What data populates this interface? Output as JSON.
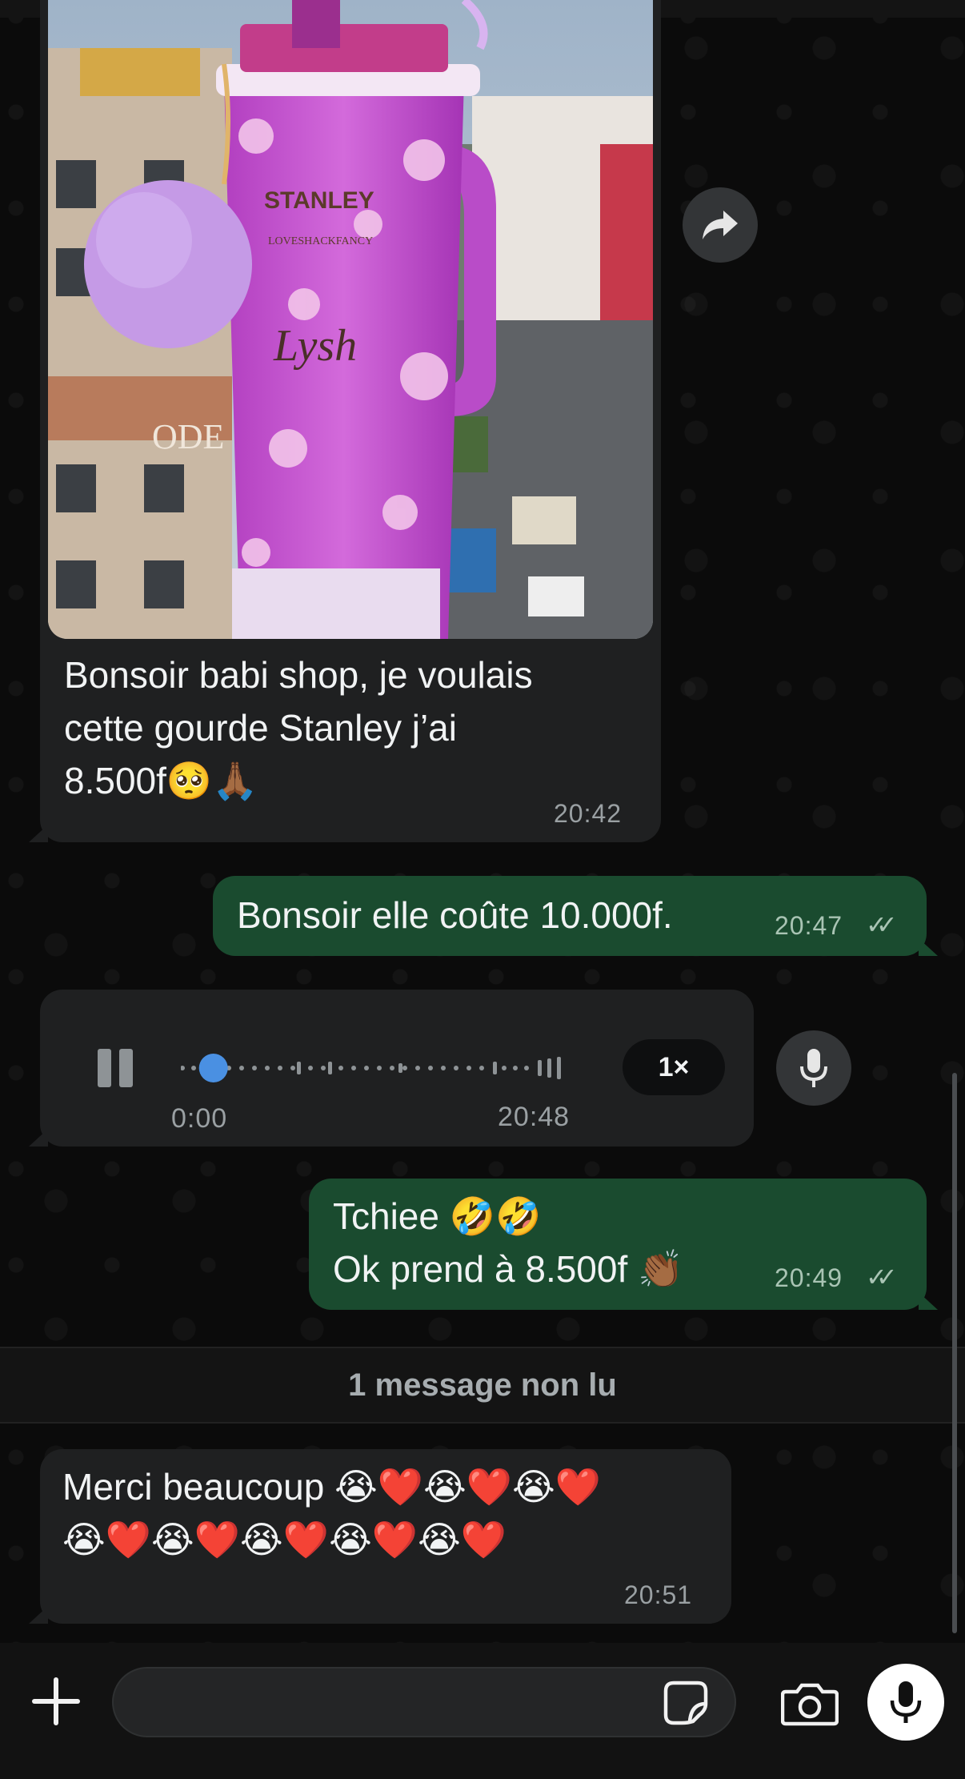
{
  "messages": [
    {
      "id": "m1",
      "direction": "incoming",
      "type": "image",
      "image_subject": "Purple floral Stanley tumbler with pom-pom keychain over city street",
      "image_lettering": [
        "STANLEY",
        "LOVESHACKFANCY",
        "Lysh",
        "ODE"
      ],
      "caption": "Bonsoir babi shop, je voulais\ncette gourde Stanley j’ai\n8.500f🥺🙏🏾",
      "time": "20:42"
    },
    {
      "id": "m2",
      "direction": "outgoing",
      "type": "text",
      "text": "Bonsoir elle coûte 10.000f.",
      "time": "20:47",
      "status": "read"
    },
    {
      "id": "m3",
      "direction": "incoming",
      "type": "voice",
      "position": "0:00",
      "progress": 0.05,
      "speed": "1×",
      "time": "20:48"
    },
    {
      "id": "m4",
      "direction": "outgoing",
      "type": "text",
      "text": "Tchiee 🤣🤣\nOk prend à 8.500f 👏🏾",
      "time": "20:49",
      "status": "read"
    },
    {
      "id": "m5",
      "direction": "incoming",
      "type": "text",
      "text": "Merci beaucoup 😭❤️😭❤️😭❤️\n😭❤️😭❤️😭❤️😭❤️😭❤️",
      "time": "20:51"
    }
  ],
  "unread_banner": "1 message non lu",
  "composer": {
    "placeholder": "",
    "icons": [
      "plus-icon",
      "sticker-icon",
      "camera-icon",
      "microphone-icon"
    ]
  },
  "colors": {
    "incoming_bubble": "#1f2021",
    "outgoing_bubble": "#1a4b2f",
    "background": "#0b0b0b",
    "voice_accent": "#4a90e2"
  }
}
